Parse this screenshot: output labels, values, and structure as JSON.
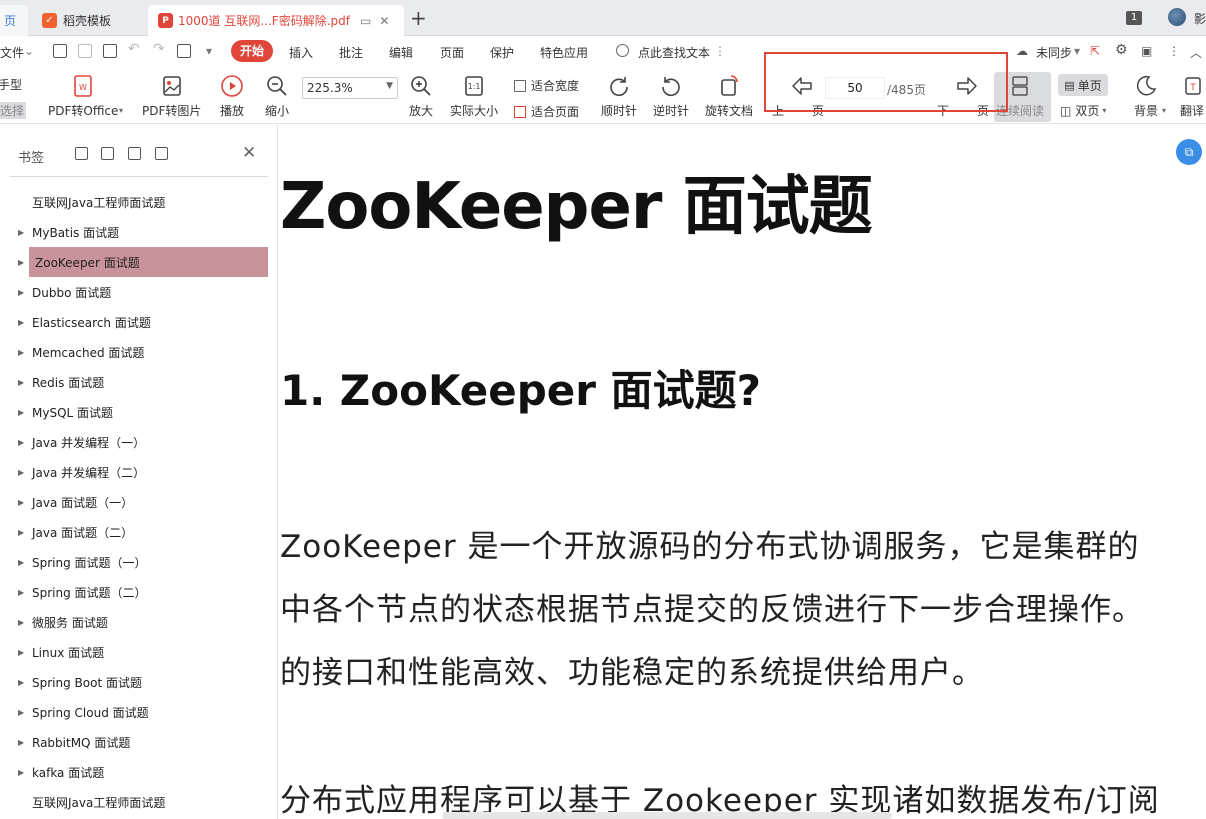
{
  "tabs": {
    "home_label": "页",
    "daoke_label": "稻壳模板",
    "pdf_label": "1000道 互联网...F密码解除.pdf",
    "badge": "1",
    "user_char": "影"
  },
  "menu": {
    "file": "文件",
    "start": "开始",
    "items": [
      "插入",
      "批注",
      "编辑",
      "页面",
      "保护",
      "特色应用"
    ],
    "search": "点此查找文本",
    "sync": "未同步"
  },
  "ribbon": {
    "hand": "手型",
    "select": "选择",
    "pdf_to_office": "PDF转Office",
    "pdf_to_image": "PDF转图片",
    "play": "播放",
    "zoom_out": "缩小",
    "zoom_value": "225.3%",
    "zoom_in": "放大",
    "actual_size": "实际大小",
    "one_to_one": "1:1",
    "fit_width": "适合宽度",
    "fit_page": "适合页面",
    "clockwise": "顺时针",
    "counterclockwise": "逆时针",
    "rotate_doc": "旋转文档",
    "prev_page": "上一页",
    "next_page": "下一页",
    "page_current": "50",
    "page_total": "/485页",
    "continuous": "连续阅读",
    "single": "单页",
    "double": "双页",
    "background": "背景",
    "translate": "翻译"
  },
  "sidebar": {
    "title": "书签",
    "items": [
      {
        "label": "互联网Java工程师面试题",
        "arrow": false
      },
      {
        "label": "MyBatis 面试题",
        "arrow": true
      },
      {
        "label": "ZooKeeper 面试题",
        "arrow": true,
        "active": true
      },
      {
        "label": "Dubbo 面试题",
        "arrow": true
      },
      {
        "label": "Elasticsearch 面试题",
        "arrow": true
      },
      {
        "label": "Memcached 面试题",
        "arrow": true
      },
      {
        "label": "Redis 面试题",
        "arrow": true
      },
      {
        "label": "MySQL 面试题",
        "arrow": true
      },
      {
        "label": "Java 并发编程（一）",
        "arrow": true
      },
      {
        "label": "Java 并发编程（二）",
        "arrow": true
      },
      {
        "label": "Java 面试题（一）",
        "arrow": true
      },
      {
        "label": "Java 面试题（二）",
        "arrow": true
      },
      {
        "label": "Spring 面试题（一）",
        "arrow": true
      },
      {
        "label": "Spring 面试题（二）",
        "arrow": true
      },
      {
        "label": "微服务 面试题",
        "arrow": true
      },
      {
        "label": "Linux 面试题",
        "arrow": true
      },
      {
        "label": "Spring Boot 面试题",
        "arrow": true
      },
      {
        "label": "Spring Cloud 面试题",
        "arrow": true
      },
      {
        "label": "RabbitMQ 面试题",
        "arrow": true
      },
      {
        "label": "kafka 面试题",
        "arrow": true
      },
      {
        "label": "互联网Java工程师面试题",
        "arrow": false
      }
    ]
  },
  "document": {
    "title": "ZooKeeper  面试题",
    "heading": "1. ZooKeeper  面试题?",
    "para1_line1": "ZooKeeper 是一个开放源码的分布式协调服务，它是集群的",
    "para1_line2": "中各个节点的状态根据节点提交的反馈进行下一步合理操作。",
    "para1_line3": "的接口和性能高效、功能稳定的系统提供给用户。",
    "para2_line1": "分布式应用程序可以基于 Zookeeper 实现诸如数据发布/订阅"
  }
}
